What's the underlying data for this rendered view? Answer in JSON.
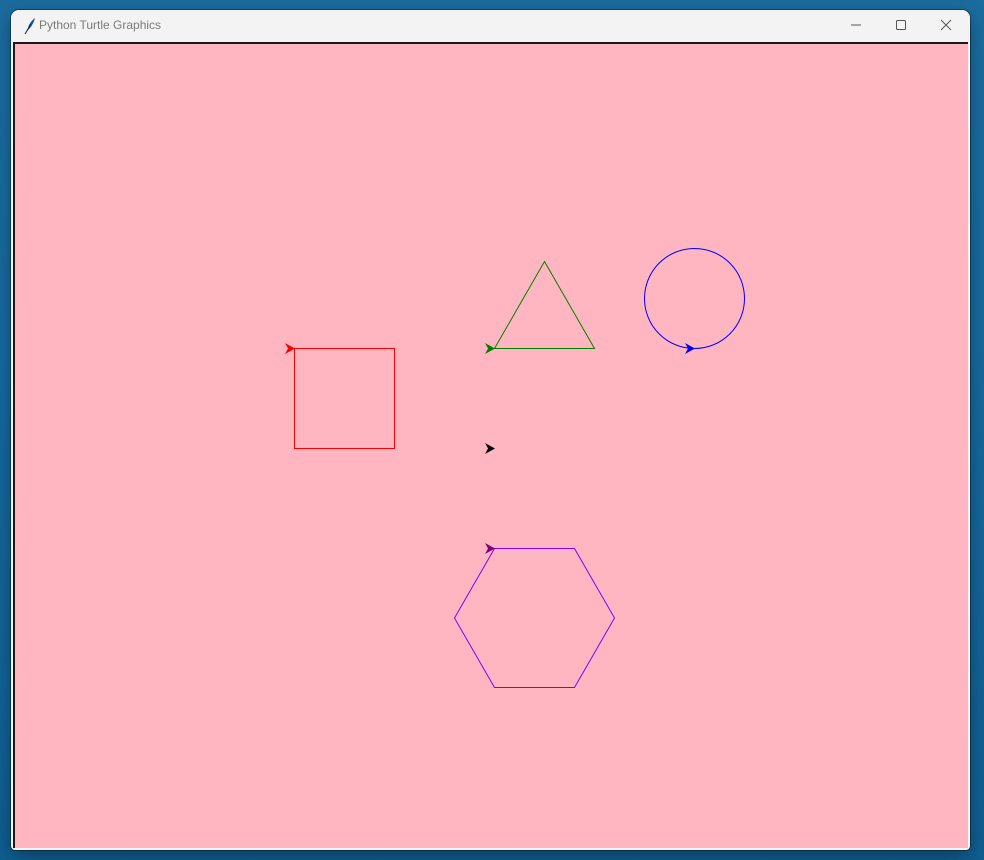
{
  "window": {
    "title": "Python Turtle Graphics",
    "app_icon": "feather-icon"
  },
  "titlebar_buttons": {
    "minimize_icon": "minimize-icon",
    "maximize_icon": "maximize-icon",
    "close_icon": "close-icon"
  },
  "canvas": {
    "background_color": "#ffb6c1",
    "shapes": [
      {
        "name": "square",
        "color": "#ff0000"
      },
      {
        "name": "triangle",
        "color": "#008000"
      },
      {
        "name": "circle",
        "color": "#0000ff"
      },
      {
        "name": "hexagon",
        "color": "#800080"
      }
    ],
    "turtles": [
      {
        "name": "red-turtle",
        "color": "#ff0000"
      },
      {
        "name": "green-turtle",
        "color": "#008000"
      },
      {
        "name": "blue-turtle",
        "color": "#0000ff"
      },
      {
        "name": "black-turtle",
        "color": "#000000"
      },
      {
        "name": "purple-turtle",
        "color": "#800080"
      }
    ]
  }
}
